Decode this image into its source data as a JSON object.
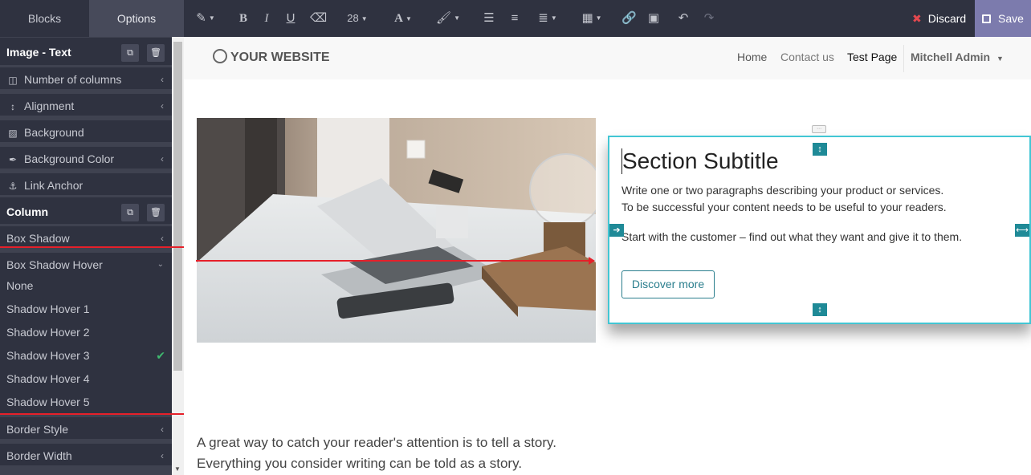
{
  "topbar": {
    "tabs": [
      "Blocks",
      "Options"
    ],
    "font_size": "28",
    "discard_label": "Discard",
    "save_label": "Save"
  },
  "sidebar": {
    "section1_title": "Image - Text",
    "section1_items": [
      "Number of columns",
      "Alignment",
      "Background",
      "Background Color",
      "Link Anchor"
    ],
    "section2_title": "Column",
    "section2_items": [
      "Box Shadow",
      "Box Shadow Hover"
    ],
    "hover_options": [
      "None",
      "Shadow Hover 1",
      "Shadow Hover 2",
      "Shadow Hover 3",
      "Shadow Hover 4",
      "Shadow Hover 5"
    ],
    "selected_hover": "Shadow Hover 3",
    "bottom_items": [
      "Border Style",
      "Border Width"
    ]
  },
  "navbar": {
    "brand": "YOUR WEBSITE",
    "items": [
      "Home",
      "Contact us",
      "Test Page"
    ],
    "user": "Mitchell Admin"
  },
  "content": {
    "subtitle": "Section Subtitle",
    "para1_line1": "Write one or two paragraphs describing your product or services.",
    "para1_line2": "To be successful your content needs to be useful to your readers.",
    "para2": "Start with the customer – find out what they want and give it to them.",
    "button": "Discover more"
  },
  "story": {
    "line1": "A great way to catch your reader's attention is to tell a story.",
    "line2": "Everything you consider writing can be told as a story."
  },
  "colors": {
    "toolbar_bg": "#2f3240",
    "save_bg": "#7c7bad",
    "selection_border": "#42c6d4",
    "handle": "#1f8a97",
    "annotation_red": "#e6202a",
    "check_green": "#3fb96f"
  }
}
